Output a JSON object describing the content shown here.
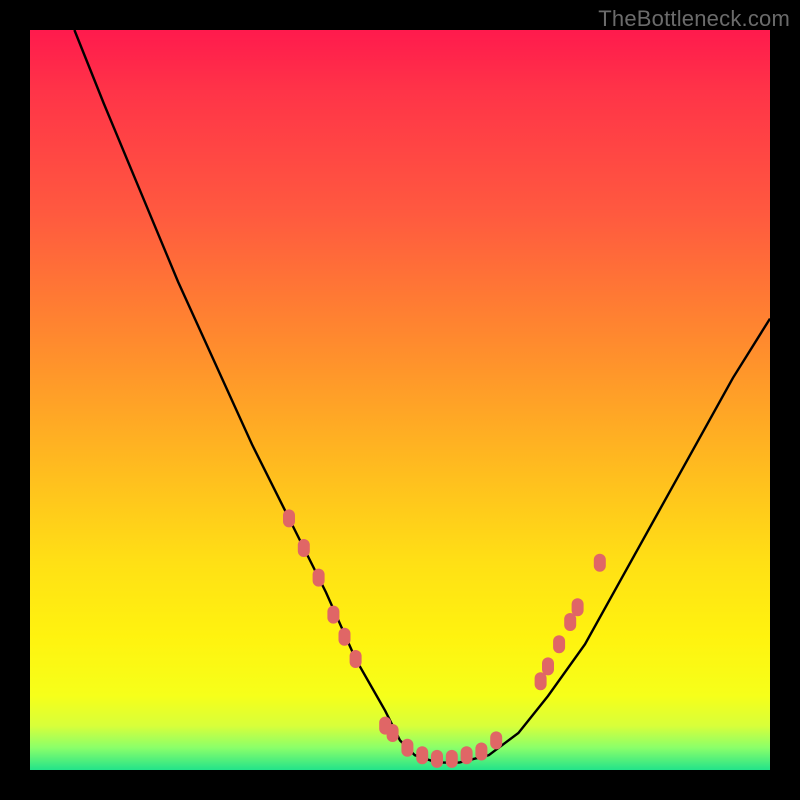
{
  "watermark": "TheBottleneck.com",
  "chart_data": {
    "type": "line",
    "title": "",
    "xlabel": "",
    "ylabel": "",
    "xlim": [
      0,
      100
    ],
    "ylim": [
      0,
      100
    ],
    "grid": false,
    "legend": false,
    "annotations": [],
    "series": [
      {
        "name": "bottleneck-curve",
        "color": "#000000",
        "x": [
          6,
          10,
          15,
          20,
          25,
          30,
          35,
          40,
          44,
          48,
          50,
          52,
          55,
          58,
          62,
          66,
          70,
          75,
          80,
          85,
          90,
          95,
          100
        ],
        "y": [
          100,
          90,
          78,
          66,
          55,
          44,
          34,
          24,
          15,
          8,
          4,
          2,
          1,
          1,
          2,
          5,
          10,
          17,
          26,
          35,
          44,
          53,
          61
        ]
      }
    ],
    "value_markers": {
      "color": "#e06666",
      "points": [
        {
          "x": 35,
          "y": 34
        },
        {
          "x": 37,
          "y": 30
        },
        {
          "x": 39,
          "y": 26
        },
        {
          "x": 41,
          "y": 21
        },
        {
          "x": 42.5,
          "y": 18
        },
        {
          "x": 44,
          "y": 15
        },
        {
          "x": 48,
          "y": 6
        },
        {
          "x": 49,
          "y": 5
        },
        {
          "x": 51,
          "y": 3
        },
        {
          "x": 53,
          "y": 2
        },
        {
          "x": 55,
          "y": 1.5
        },
        {
          "x": 57,
          "y": 1.5
        },
        {
          "x": 59,
          "y": 2
        },
        {
          "x": 61,
          "y": 2.5
        },
        {
          "x": 63,
          "y": 4
        },
        {
          "x": 69,
          "y": 12
        },
        {
          "x": 70,
          "y": 14
        },
        {
          "x": 71.5,
          "y": 17
        },
        {
          "x": 73,
          "y": 20
        },
        {
          "x": 74,
          "y": 22
        },
        {
          "x": 77,
          "y": 28
        }
      ]
    }
  }
}
